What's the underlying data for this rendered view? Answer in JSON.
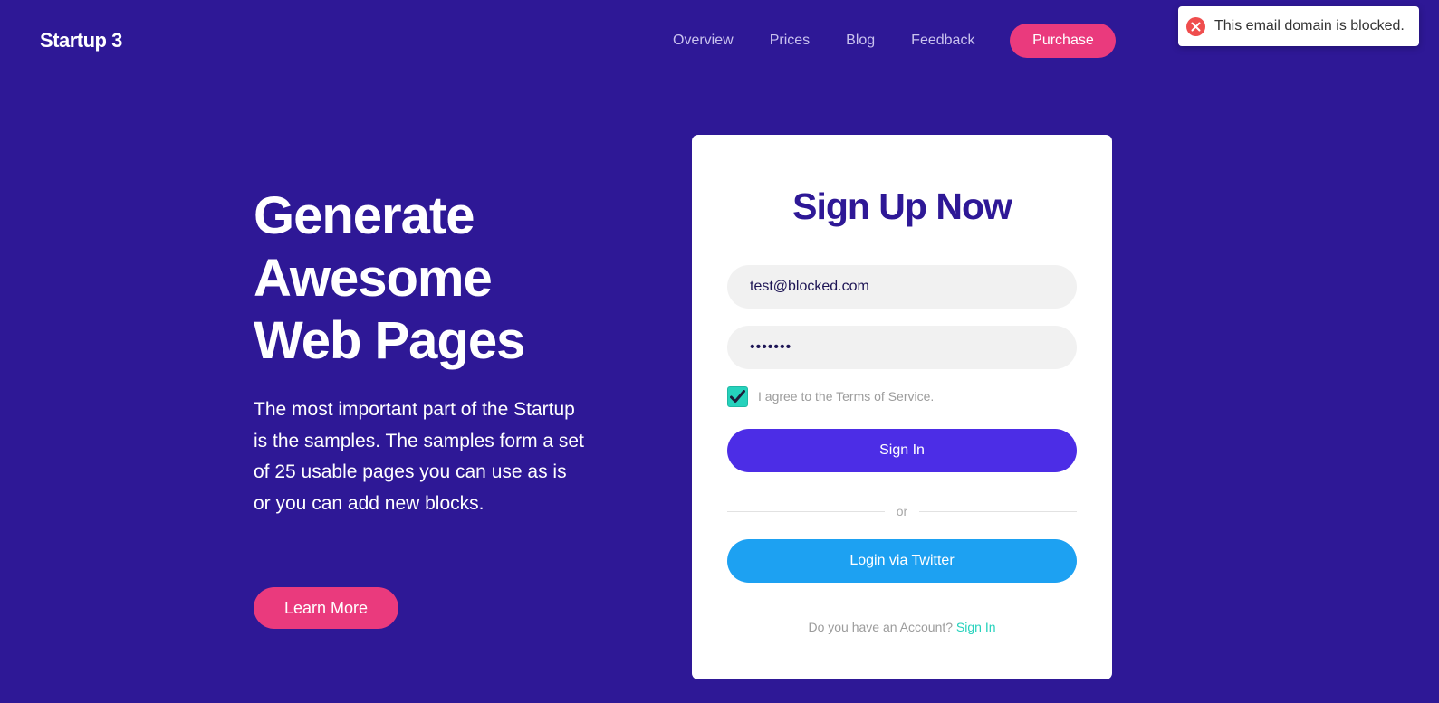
{
  "header": {
    "logo": "Startup 3",
    "nav": [
      "Overview",
      "Prices",
      "Blog",
      "Feedback"
    ],
    "purchase_label": "Purchase"
  },
  "toast": {
    "message": "This email domain is blocked.",
    "icon": "error-circle-x-icon",
    "color": "#ef4d4d"
  },
  "hero": {
    "title_lines": [
      "Generate",
      "Awesome",
      "Web Pages"
    ],
    "text": "The most important part of the Startup is the samples. The samples form a set of 25 usable pages you can use as is or you can add new blocks.",
    "button_label": "Learn More"
  },
  "signup": {
    "title": "Sign Up Now",
    "email_value": "test@blocked.com",
    "password_value": "•••••••",
    "terms_checked": true,
    "terms_label": "I agree to the Terms of Service.",
    "signin_label": "Sign In",
    "divider_text": "or",
    "twitter_label": "Login via Twitter",
    "account_question": "Do you have an Account?",
    "account_link": "Sign In"
  },
  "colors": {
    "background": "#2e1896",
    "accent_pink": "#ea3a7d",
    "primary_button": "#4c2de6",
    "twitter": "#1da1f2",
    "teal": "#25d2bc"
  }
}
